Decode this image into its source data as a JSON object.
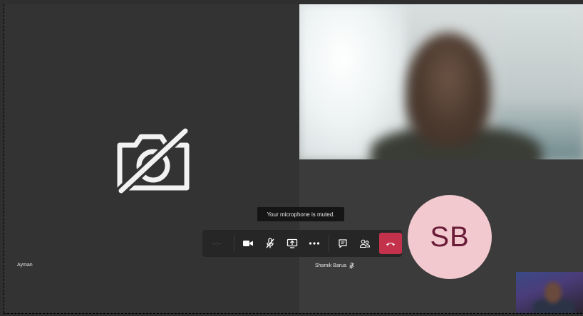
{
  "meeting": {
    "tooltip": "Your microphone is muted.",
    "timer": "--:--"
  },
  "participants": [
    {
      "name": "Ayman",
      "video": "off",
      "icon": "camera-off-icon"
    },
    {
      "name": "Shamik Barua",
      "video": "on",
      "muted": true,
      "icon": "mic-off-icon"
    },
    {
      "initials": "SB",
      "avatar_color": "#f2c9cf",
      "text_color": "#6a1b38"
    }
  ],
  "toolbar": {
    "buttons": [
      {
        "id": "camera",
        "icon": "camera-icon"
      },
      {
        "id": "mic",
        "icon": "mic-off-icon",
        "state": "muted"
      },
      {
        "id": "share",
        "icon": "share-screen-icon"
      },
      {
        "id": "more",
        "icon": "more-options-icon",
        "label": "•••"
      },
      {
        "id": "chat",
        "icon": "chat-icon"
      },
      {
        "id": "participants",
        "icon": "participants-icon"
      },
      {
        "id": "hangup",
        "icon": "hang-up-icon",
        "color": "#c4314b"
      }
    ]
  },
  "colors": {
    "stage_background": "#333333",
    "toolbar_background": "#262626",
    "hangup_red": "#c4314b"
  }
}
